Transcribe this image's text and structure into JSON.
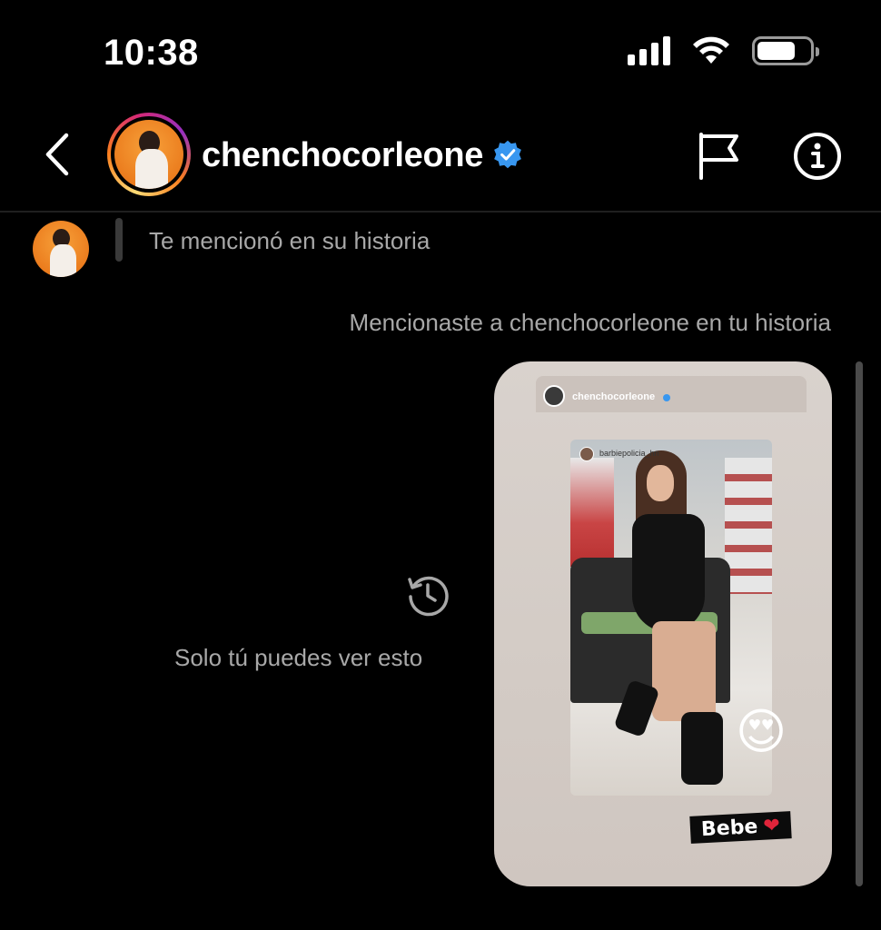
{
  "status_bar": {
    "time": "10:38"
  },
  "header": {
    "username": "chenchocorleone",
    "verified": true,
    "icons": [
      "back-chevron-icon",
      "flag-icon",
      "info-icon",
      "verified-badge-icon"
    ]
  },
  "thread": {
    "mention_received": "Te mencionó en su historia",
    "mention_sent": "Mencionaste a chenchocorleone en tu historia",
    "story": {
      "author": "chenchocorleone",
      "tagged_user": "barbiepolicia_hn",
      "sticker_text": "Bebe",
      "emoji": "😍",
      "heart": "❤"
    },
    "ephemeral_note": "Solo tú puedes ver esto"
  },
  "colors": {
    "background": "#000000",
    "secondary_text": "#a8a8a8",
    "verified_blue": "#3897f0",
    "divider": "#1f1f1f"
  }
}
